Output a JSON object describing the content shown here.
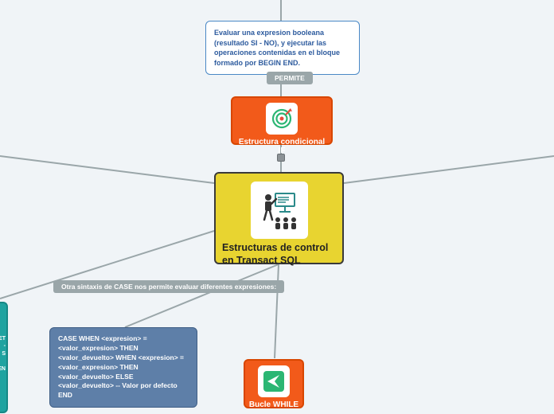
{
  "center": {
    "title": "Estructuras de control en Transact SQL"
  },
  "if_node": {
    "title": "Estructura condicional IF",
    "note": "Evaluar una expresion booleana (resultado SI - NO), y ejecutar las operaciones contenidas en el bloque formado por BEGIN END.",
    "edge_label": "PERMITE"
  },
  "while_node": {
    "title": "Bucle WHILE"
  },
  "case_branch": {
    "label": "Otra sintaxis de CASE nos permite evaluar diferentes expresiones:",
    "code": "CASE        WHEN <expresion> = <valor_expresion> THEN <valor_devuelto>       WHEN <expresion> = <valor_expresion> THEN <valor_devuelto>        ELSE <valor_devuelto> -- Valor por defecto  END"
  },
  "fragment_left": "ET\n-\nS\n\nEN"
}
